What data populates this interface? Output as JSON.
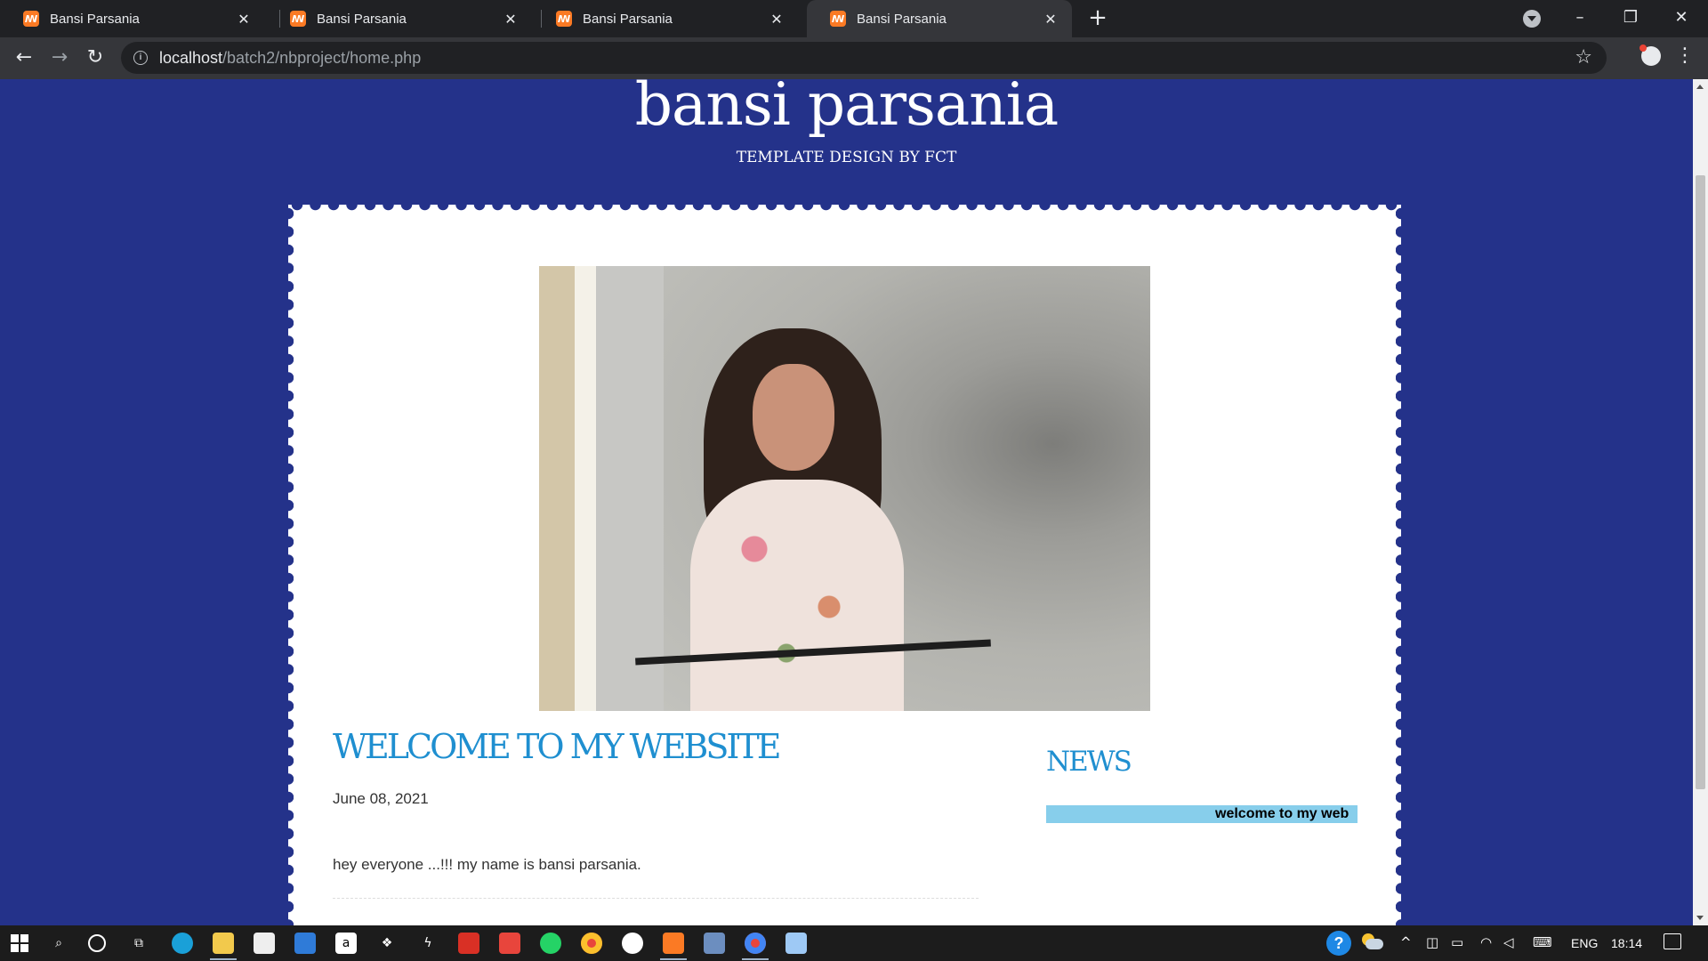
{
  "browser": {
    "tabs": [
      {
        "title": "Bansi Parsania",
        "active": false
      },
      {
        "title": "Bansi Parsania",
        "active": false
      },
      {
        "title": "Bansi Parsania",
        "active": false
      },
      {
        "title": "Bansi Parsania",
        "active": true
      }
    ],
    "favicon_glyph": "ꟿ",
    "new_tab": "+",
    "url_host": "localhost",
    "url_path": "/batch2/nbproject/home.php",
    "icons": {
      "back": "back-arrow-icon",
      "forward": "forward-arrow-icon",
      "reload": "reload-icon",
      "site_info": "info-icon",
      "bookmark": "star-icon",
      "extension": "extension-icon",
      "menu": "kebab-menu-icon"
    },
    "window_controls": {
      "minimize": "–",
      "restore": "❐",
      "close": "✕"
    }
  },
  "site": {
    "title": "bansi parsania",
    "tagline": "TEMPLATE DESIGN BY FCT",
    "colors": {
      "background": "#24328a",
      "heading": "#1f8fd0",
      "ticker": "#87ceeb"
    }
  },
  "post": {
    "heading": "WELCOME TO MY WEBSITE",
    "date": "June 08, 2021",
    "body": "hey everyone ...!!! my name is bansi parsania."
  },
  "news": {
    "heading": "NEWS",
    "ticker": "welcome to my web"
  },
  "taskbar": {
    "apps": [
      "search",
      "cortana",
      "task-view",
      "edge",
      "file-explorer",
      "store",
      "mail",
      "amazon",
      "dropbox",
      "winamp",
      "gmail",
      "anydesk",
      "whatsapp",
      "chrome",
      "github",
      "xampp",
      "virtualbox",
      "chrome-active",
      "notepad"
    ],
    "language": "ENG",
    "clock": "18:14"
  }
}
